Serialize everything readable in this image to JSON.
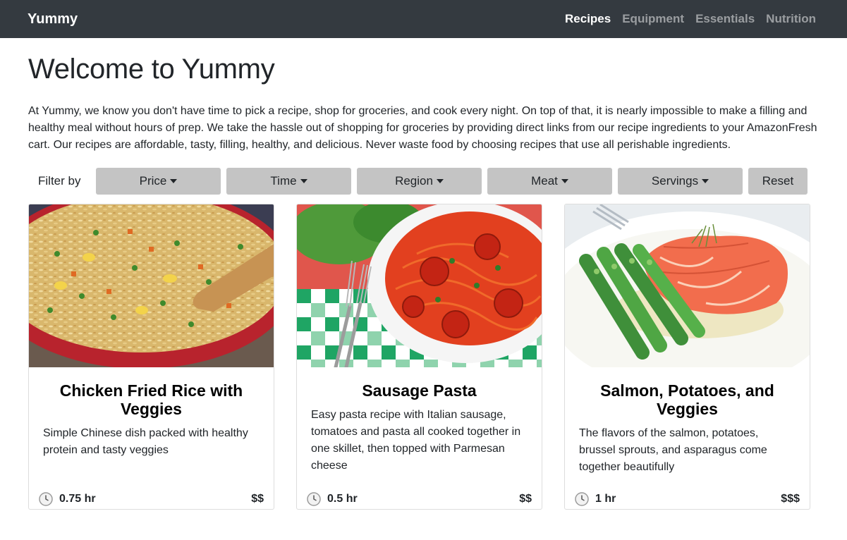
{
  "nav": {
    "brand": "Yummy",
    "links": [
      "Recipes",
      "Equipment",
      "Essentials",
      "Nutrition"
    ],
    "active": "Recipes"
  },
  "page": {
    "title": "Welcome to Yummy",
    "intro": "At Yummy, we know you don't have time to pick a recipe, shop for groceries, and cook every night. On top of that, it is nearly impossible to make a filling and healthy meal without hours of prep. We take the hassle out of shopping for groceries by providing direct links from our recipe ingredients to your AmazonFresh cart. Our recipes are affordable, tasty, filling, healthy, and delicious. Never waste food by choosing recipes that use all perishable ingredients."
  },
  "filters": {
    "label": "Filter by",
    "buttons": [
      "Price",
      "Time",
      "Region",
      "Meat",
      "Servings"
    ],
    "reset": "Reset"
  },
  "recipes": [
    {
      "title": "Chicken Fried Rice with Veggies",
      "description": "Simple Chinese dish packed with healthy protein and tasty veggies",
      "time": "0.75 hr",
      "price": "$$",
      "image_icon": "fried-rice-image"
    },
    {
      "title": "Sausage Pasta",
      "description": "Easy pasta recipe with Italian sausage, tomatoes and pasta all cooked together in one skillet, then topped with Parmesan cheese",
      "time": "0.5 hr",
      "price": "$$",
      "image_icon": "sausage-pasta-image"
    },
    {
      "title": "Salmon, Potatoes, and Veggies",
      "description": "The flavors of the salmon, potatoes, brussel sprouts, and asparagus come together beautifully",
      "time": "1 hr",
      "price": "$$$",
      "image_icon": "salmon-image"
    }
  ],
  "icons": {
    "clock": "clock-icon",
    "caret": "caret-down-icon"
  },
  "colors": {
    "navbar": "#343a40",
    "filter_button": "#c4c4c4"
  }
}
